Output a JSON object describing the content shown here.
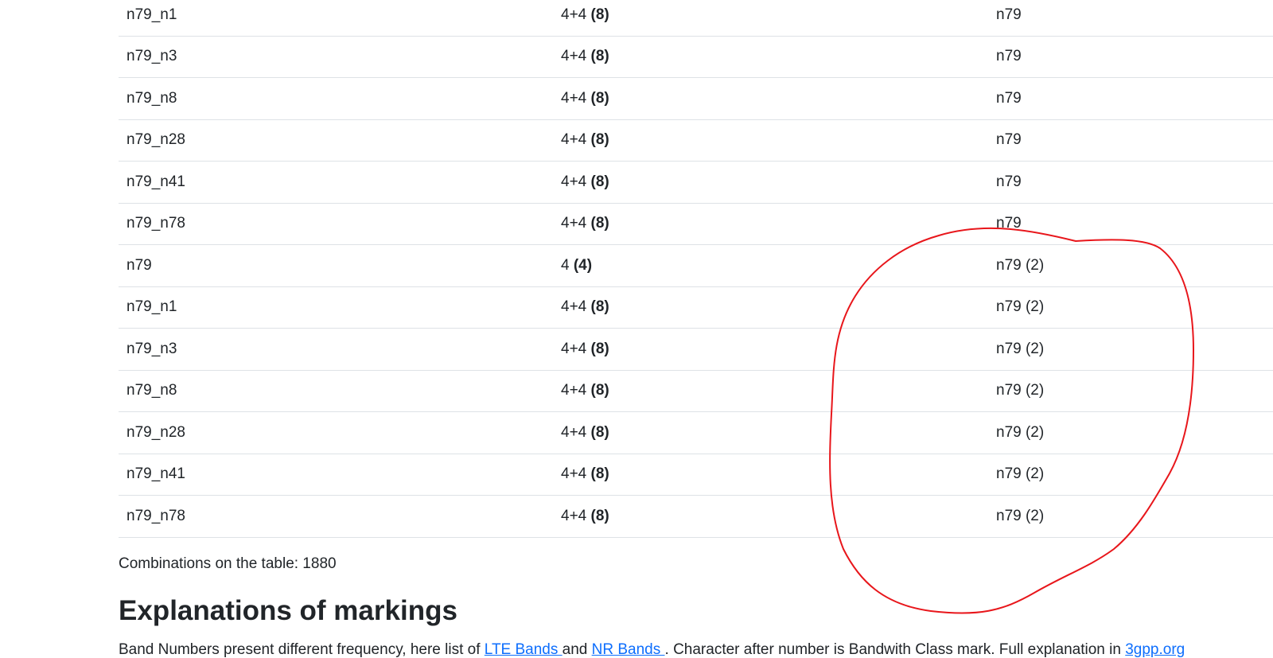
{
  "table": {
    "rows": [
      {
        "combination": "n79_n1",
        "mimo_sum": "4+4",
        "mimo_total": "(8)",
        "band": "n79"
      },
      {
        "combination": "n79_n3",
        "mimo_sum": "4+4",
        "mimo_total": "(8)",
        "band": "n79"
      },
      {
        "combination": "n79_n8",
        "mimo_sum": "4+4",
        "mimo_total": "(8)",
        "band": "n79"
      },
      {
        "combination": "n79_n28",
        "mimo_sum": "4+4",
        "mimo_total": "(8)",
        "band": "n79"
      },
      {
        "combination": "n79_n41",
        "mimo_sum": "4+4",
        "mimo_total": "(8)",
        "band": "n79"
      },
      {
        "combination": "n79_n78",
        "mimo_sum": "4+4",
        "mimo_total": "(8)",
        "band": "n79"
      },
      {
        "combination": "n79",
        "mimo_sum": "4",
        "mimo_total": "(4)",
        "band": "n79 (2)"
      },
      {
        "combination": "n79_n1",
        "mimo_sum": "4+4",
        "mimo_total": "(8)",
        "band": "n79 (2)"
      },
      {
        "combination": "n79_n3",
        "mimo_sum": "4+4",
        "mimo_total": "(8)",
        "band": "n79 (2)"
      },
      {
        "combination": "n79_n8",
        "mimo_sum": "4+4",
        "mimo_total": "(8)",
        "band": "n79 (2)"
      },
      {
        "combination": "n79_n28",
        "mimo_sum": "4+4",
        "mimo_total": "(8)",
        "band": "n79 (2)"
      },
      {
        "combination": "n79_n41",
        "mimo_sum": "4+4",
        "mimo_total": "(8)",
        "band": "n79 (2)"
      },
      {
        "combination": "n79_n78",
        "mimo_sum": "4+4",
        "mimo_total": "(8)",
        "band": "n79 (2)"
      }
    ]
  },
  "footer": {
    "combinations_text": "Combinations on the table: 1880"
  },
  "explanations": {
    "heading": "Explanations of markings",
    "text_before": "Band Numbers present different frequency, here list of ",
    "lte_link": "LTE Bands ",
    "text_and": "and ",
    "nr_link": "NR Bands ",
    "text_after": ". Character after number is Bandwith Class mark. Full explanation in ",
    "gpp_link": "3gpp.org"
  },
  "colors": {
    "text": "#212529",
    "row_border": "#dee2e6",
    "link": "#0d6efd",
    "annotation": "#e8161b"
  }
}
